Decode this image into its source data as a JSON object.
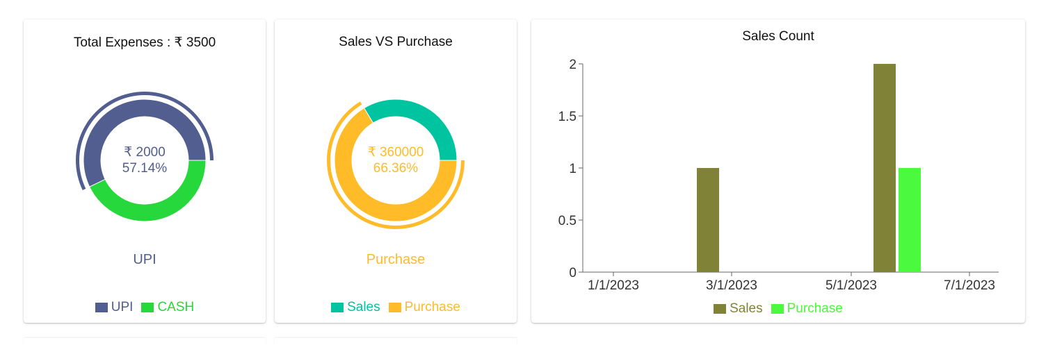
{
  "colors": {
    "upi": "#515e8f",
    "cash": "#26d83b",
    "sales_donut": "#00c49f",
    "purchase_donut": "#ffbb28",
    "sales_bar": "#808337",
    "purchase_bar": "#4bf93e"
  },
  "expenses": {
    "title": "Total Expenses : ₹ 3500",
    "center_value": "₹ 2000",
    "center_percent": "57.14%",
    "active_label": "UPI",
    "legend": [
      "UPI",
      "CASH"
    ]
  },
  "sales_vs_purchase": {
    "title": "Sales VS Purchase",
    "center_value": "₹ 360000",
    "center_percent": "66.36%",
    "active_label": "Purchase",
    "legend": [
      "Sales",
      "Purchase"
    ]
  },
  "sales_count": {
    "title": "Sales Count",
    "legend": [
      "Sales",
      "Purchase"
    ]
  },
  "chart_data": [
    {
      "type": "pie",
      "title": "Total Expenses : ₹ 3500",
      "labels": [
        "UPI",
        "CASH"
      ],
      "values": [
        2000,
        1500
      ],
      "active": "UPI",
      "legend_position": "bottom"
    },
    {
      "type": "pie",
      "title": "Sales VS Purchase",
      "labels": [
        "Sales",
        "Purchase"
      ],
      "values": [
        182500,
        360000
      ],
      "active": "Purchase",
      "legend_position": "bottom"
    },
    {
      "type": "bar",
      "title": "Sales Count",
      "x_tick_labels": [
        "1/1/2023",
        "3/1/2023",
        "5/1/2023",
        "7/1/2023"
      ],
      "bar_dates": [
        "2/1/2023",
        "6/1/2023"
      ],
      "series": [
        {
          "name": "Sales",
          "values": [
            1,
            2
          ]
        },
        {
          "name": "Purchase",
          "values": [
            0,
            1
          ]
        }
      ],
      "y_ticks": [
        "0",
        "0.5",
        "1",
        "1.5",
        "2"
      ],
      "ylim": [
        0,
        2
      ],
      "grid": false,
      "legend_position": "bottom"
    }
  ]
}
